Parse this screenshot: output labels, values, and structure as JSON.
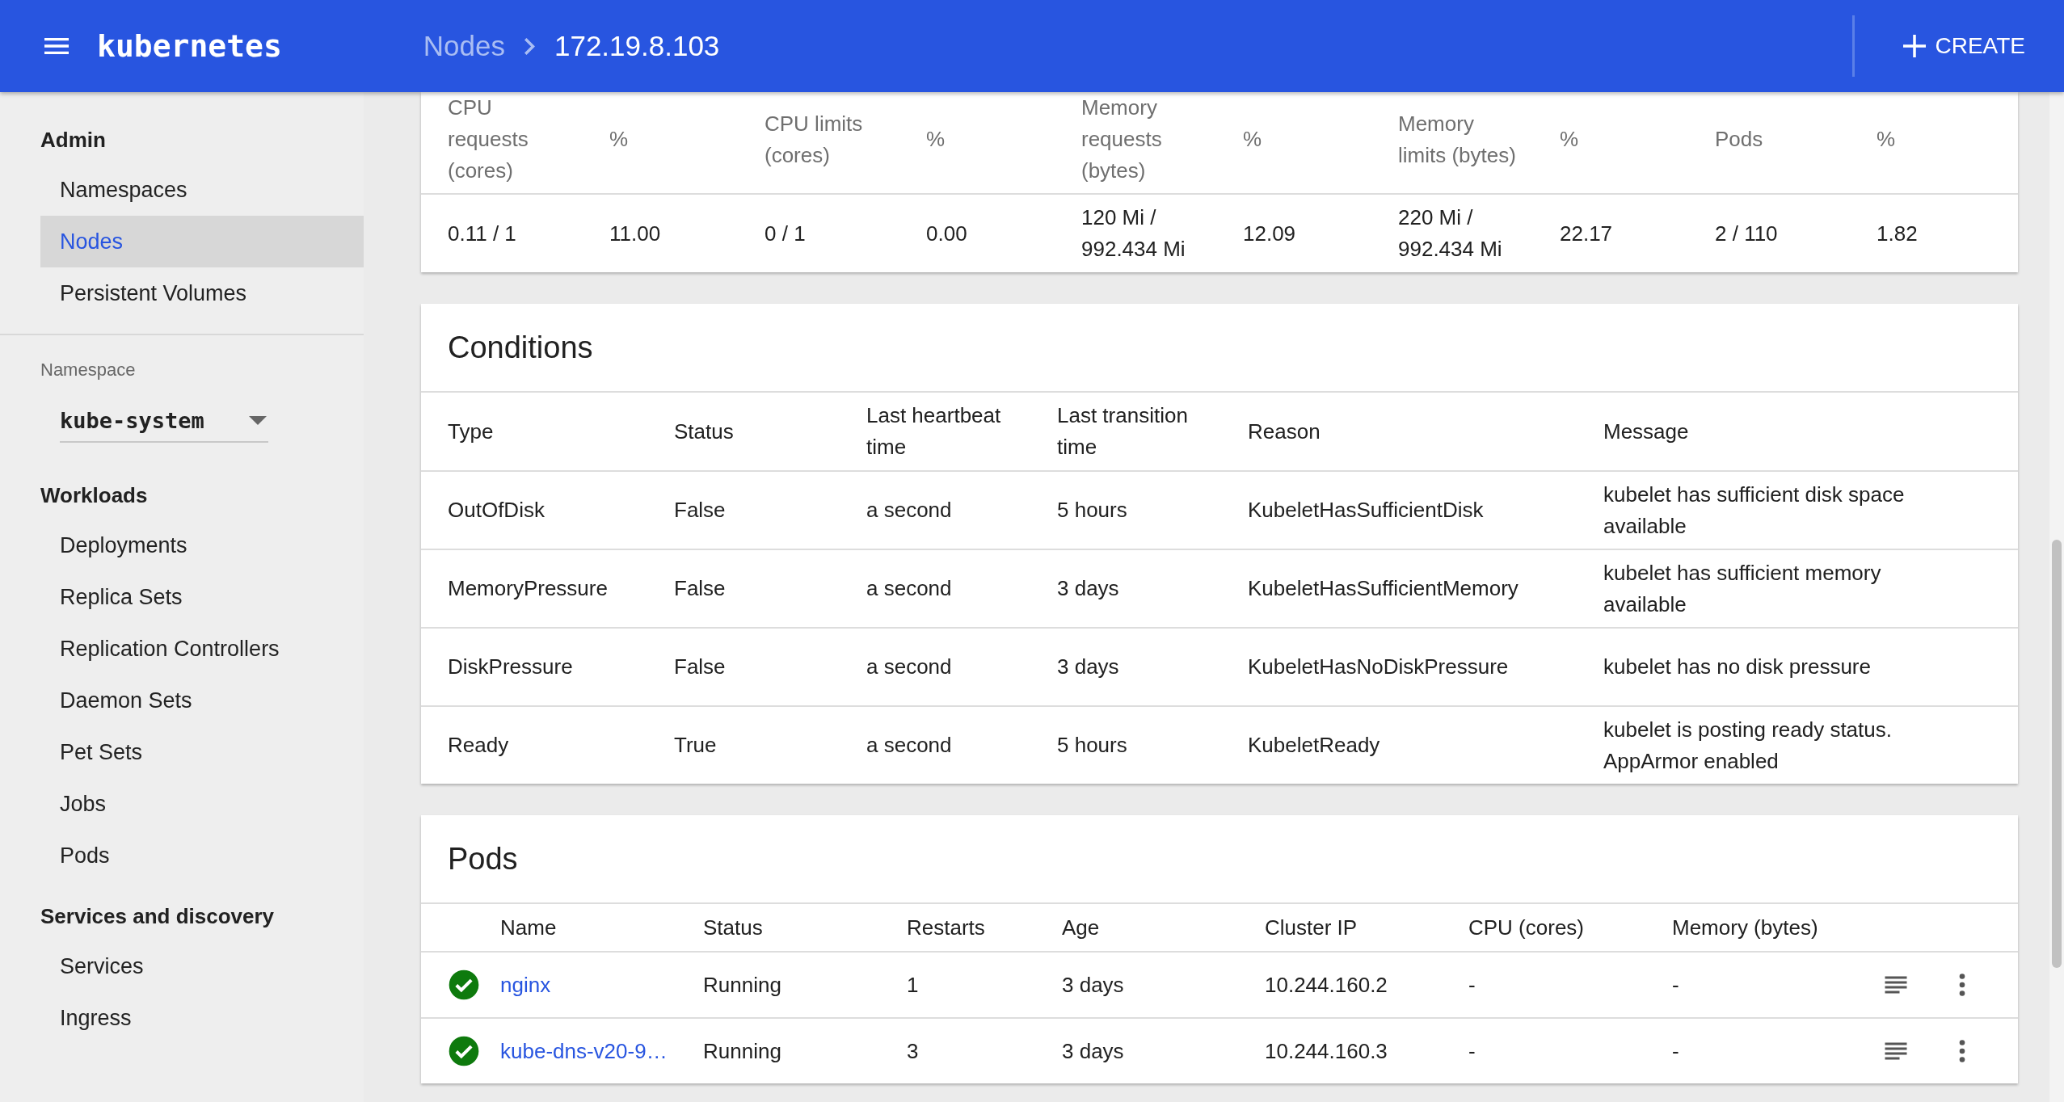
{
  "header": {
    "title": "kubernetes",
    "breadcrumbs": [
      {
        "label": "Nodes",
        "kind": "link"
      },
      {
        "label": "172.19.8.103",
        "kind": "current"
      }
    ],
    "create_button": "CREATE"
  },
  "sidebar": {
    "groups": [
      {
        "kind": "nav",
        "title": "Admin",
        "items": [
          {
            "label": "Namespaces",
            "selected": false
          },
          {
            "label": "Nodes",
            "selected": true
          },
          {
            "label": "Persistent Volumes",
            "selected": false
          }
        ]
      },
      {
        "kind": "namespace",
        "label": "Namespace",
        "value": "kube-system"
      },
      {
        "kind": "nav",
        "title": "Workloads",
        "items": [
          {
            "label": "Deployments",
            "selected": false
          },
          {
            "label": "Replica Sets",
            "selected": false
          },
          {
            "label": "Replication Controllers",
            "selected": false
          },
          {
            "label": "Daemon Sets",
            "selected": false
          },
          {
            "label": "Pet Sets",
            "selected": false
          },
          {
            "label": "Jobs",
            "selected": false
          },
          {
            "label": "Pods",
            "selected": false
          }
        ]
      },
      {
        "kind": "nav",
        "title": "Services and discovery",
        "items": [
          {
            "label": "Services",
            "selected": false
          },
          {
            "label": "Ingress",
            "selected": false
          }
        ]
      }
    ]
  },
  "allocation": {
    "columns": [
      "CPU requests (cores)",
      "%",
      "CPU limits (cores)",
      "%",
      "Memory requests (bytes)",
      "%",
      "Memory limits (bytes)",
      "%",
      "Pods",
      "%"
    ],
    "rows": [
      [
        "0.11 / 1",
        "11.00",
        "0 / 1",
        "0.00",
        "120 Mi / 992.434 Mi",
        "12.09",
        "220 Mi / 992.434 Mi",
        "22.17",
        "2 / 110",
        "1.82"
      ]
    ]
  },
  "conditions": {
    "title": "Conditions",
    "columns": [
      "Type",
      "Status",
      "Last heartbeat time",
      "Last transition time",
      "Reason",
      "Message"
    ],
    "rows": [
      [
        "OutOfDisk",
        "False",
        "a second",
        "5 hours",
        "KubeletHasSufficientDisk",
        "kubelet has sufficient disk space available"
      ],
      [
        "MemoryPressure",
        "False",
        "a second",
        "3 days",
        "KubeletHasSufficientMemory",
        "kubelet has sufficient memory available"
      ],
      [
        "DiskPressure",
        "False",
        "a second",
        "3 days",
        "KubeletHasNoDiskPressure",
        "kubelet has no disk pressure"
      ],
      [
        "Ready",
        "True",
        "a second",
        "5 hours",
        "KubeletReady",
        "kubelet is posting ready status. AppArmor enabled"
      ]
    ]
  },
  "pods": {
    "title": "Pods",
    "columns": [
      "Name",
      "Status",
      "Restarts",
      "Age",
      "Cluster IP",
      "CPU (cores)",
      "Memory (bytes)"
    ],
    "rows": [
      {
        "healthy": true,
        "name": "nginx",
        "status": "Running",
        "restarts": "1",
        "age": "3 days",
        "cluster_ip": "10.244.160.2",
        "cpu": "-",
        "memory": "-"
      },
      {
        "healthy": true,
        "name": "kube-dns-v20-9…",
        "status": "Running",
        "restarts": "3",
        "age": "3 days",
        "cluster_ip": "10.244.160.3",
        "cpu": "-",
        "memory": "-"
      }
    ]
  }
}
